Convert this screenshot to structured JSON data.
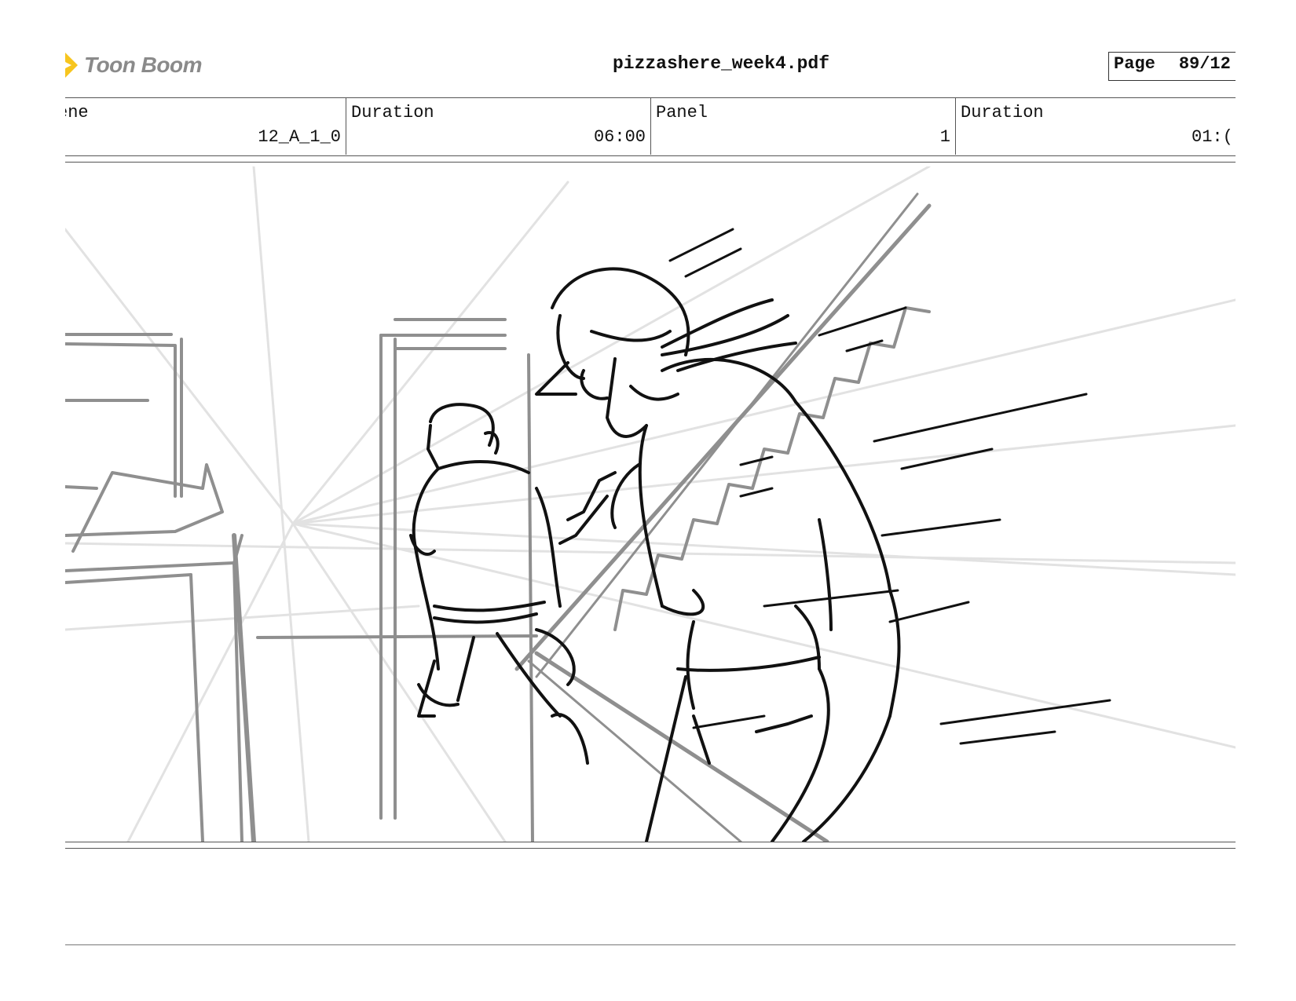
{
  "header": {
    "logo_text": "Toon Boom",
    "document_title": "pizzashere_week4.pdf",
    "page_label": "Page",
    "page_value": "89/12"
  },
  "fields": [
    {
      "label": "ene",
      "value": "12_A_1_0"
    },
    {
      "label": "Duration",
      "value": "06:00"
    },
    {
      "label": "Panel",
      "value": "1"
    },
    {
      "label": "Duration",
      "value": "01:("
    }
  ],
  "colors": {
    "logo_accent": "#f7c51e",
    "logo_text": "#8a8a8a",
    "sketch_dark": "#111111",
    "sketch_mid": "#8f8f8f",
    "sketch_light": "#dcdcdc"
  }
}
